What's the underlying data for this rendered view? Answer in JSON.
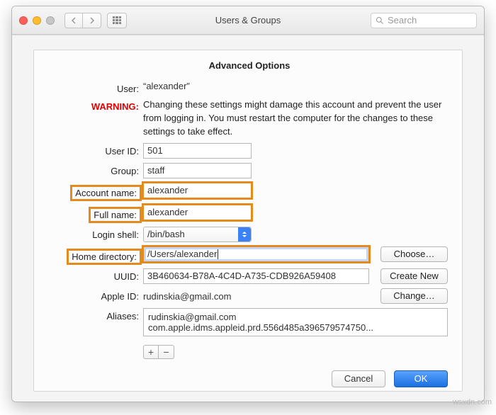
{
  "window": {
    "title": "Users & Groups",
    "search_placeholder": "Search"
  },
  "sheet": {
    "title": "Advanced Options",
    "user_label": "User:",
    "user_value": "“alexander”",
    "warning_label": "WARNING:",
    "warning_text": "Changing these settings might damage this account and prevent the user from logging in. You must restart the computer for the changes to these settings to take effect.",
    "fields": {
      "user_id": {
        "label": "User ID:",
        "value": "501"
      },
      "group": {
        "label": "Group:",
        "value": "staff"
      },
      "account_name": {
        "label": "Account name:",
        "value": "alexander"
      },
      "full_name": {
        "label": "Full name:",
        "value": "alexander"
      },
      "login_shell": {
        "label": "Login shell:",
        "value": "/bin/bash"
      },
      "home_dir": {
        "label": "Home directory:",
        "value": "/Users/alexander"
      },
      "uuid": {
        "label": "UUID:",
        "value": "3B460634-B78A-4C4D-A735-CDB926A59408"
      },
      "apple_id": {
        "label": "Apple ID:",
        "value": "rudinskia@gmail.com"
      },
      "aliases": {
        "label": "Aliases:",
        "lines": [
          "rudinskia@gmail.com",
          "com.apple.idms.appleid.prd.556d485a396579574750..."
        ]
      }
    },
    "buttons": {
      "choose": "Choose…",
      "create_new": "Create New",
      "change": "Change…",
      "cancel": "Cancel",
      "ok": "OK"
    }
  },
  "watermark": "wsxdn.com"
}
